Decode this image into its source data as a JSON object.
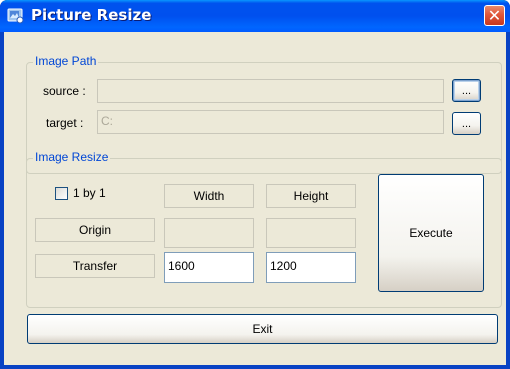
{
  "window": {
    "title": "Picture Resize",
    "close_glyph": "✕",
    "icon": "picture-resize-app-icon"
  },
  "image_path": {
    "group_title": "Image Path",
    "source_label": "source :",
    "source_value": "",
    "target_label": "target :",
    "target_value": "C:",
    "browse_label": "..."
  },
  "image_resize": {
    "group_title": "Image Resize",
    "checkbox_label": "1 by 1",
    "checkbox_checked": false,
    "width_header": "Width",
    "height_header": "Height",
    "origin_label": "Origin",
    "origin_width": "",
    "origin_height": "",
    "transfer_label": "Transfer",
    "transfer_width": "1600",
    "transfer_height": "1200",
    "execute_label": "Execute"
  },
  "footer": {
    "exit_label": "Exit"
  },
  "colors": {
    "titlebar": "#0054e3",
    "group_title": "#0046d5",
    "client_bg": "#ece9d8",
    "close_button": "#e0573a"
  }
}
